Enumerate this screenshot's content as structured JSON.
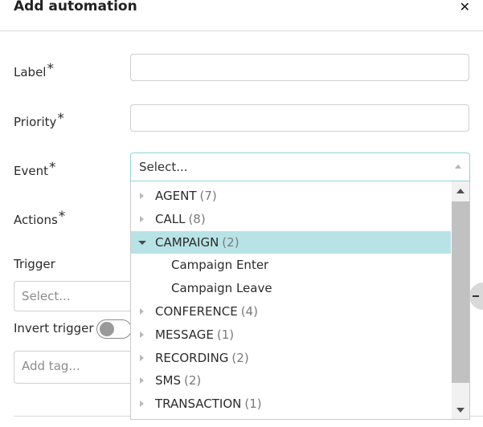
{
  "dialog": {
    "title": "Add automation",
    "close_glyph": "✕"
  },
  "form": {
    "label": {
      "label": "Label",
      "required": "*",
      "value": ""
    },
    "priority": {
      "label": "Priority",
      "required": "*",
      "value": ""
    },
    "event": {
      "label": "Event",
      "required": "*",
      "placeholder": "Select..."
    },
    "actions": {
      "label": "Actions",
      "required": "*"
    },
    "trigger": {
      "label": "Trigger",
      "placeholder": "Select..."
    },
    "invert_trigger": {
      "label": "Invert trigger",
      "checked": false
    },
    "tags": {
      "placeholder": "Add tag..."
    }
  },
  "event_dropdown": {
    "items": [
      {
        "label": "AGENT",
        "count": "(7)",
        "expanded": false
      },
      {
        "label": "CALL",
        "count": "(8)",
        "expanded": false
      },
      {
        "label": "CAMPAIGN",
        "count": "(2)",
        "expanded": true,
        "selected": true
      },
      {
        "label": "Campaign Enter",
        "child": true
      },
      {
        "label": "Campaign Leave",
        "child": true
      },
      {
        "label": "CONFERENCE",
        "count": "(4)",
        "expanded": false
      },
      {
        "label": "MESSAGE",
        "count": "(1)",
        "expanded": false
      },
      {
        "label": "RECORDING",
        "count": "(2)",
        "expanded": false
      },
      {
        "label": "SMS",
        "count": "(2)",
        "expanded": false
      },
      {
        "label": "TRANSACTION",
        "count": "(1)",
        "expanded": false
      }
    ]
  },
  "icons": {
    "close": "close-icon",
    "caret_up": "chevron-up-icon",
    "collapsed": "caret-right-icon",
    "expanded": "caret-down-icon"
  },
  "colors": {
    "selected_row": "#b8e3e6",
    "focus_border": "#8fd3d8",
    "scrollbar_thumb": "#c1c1c1"
  }
}
